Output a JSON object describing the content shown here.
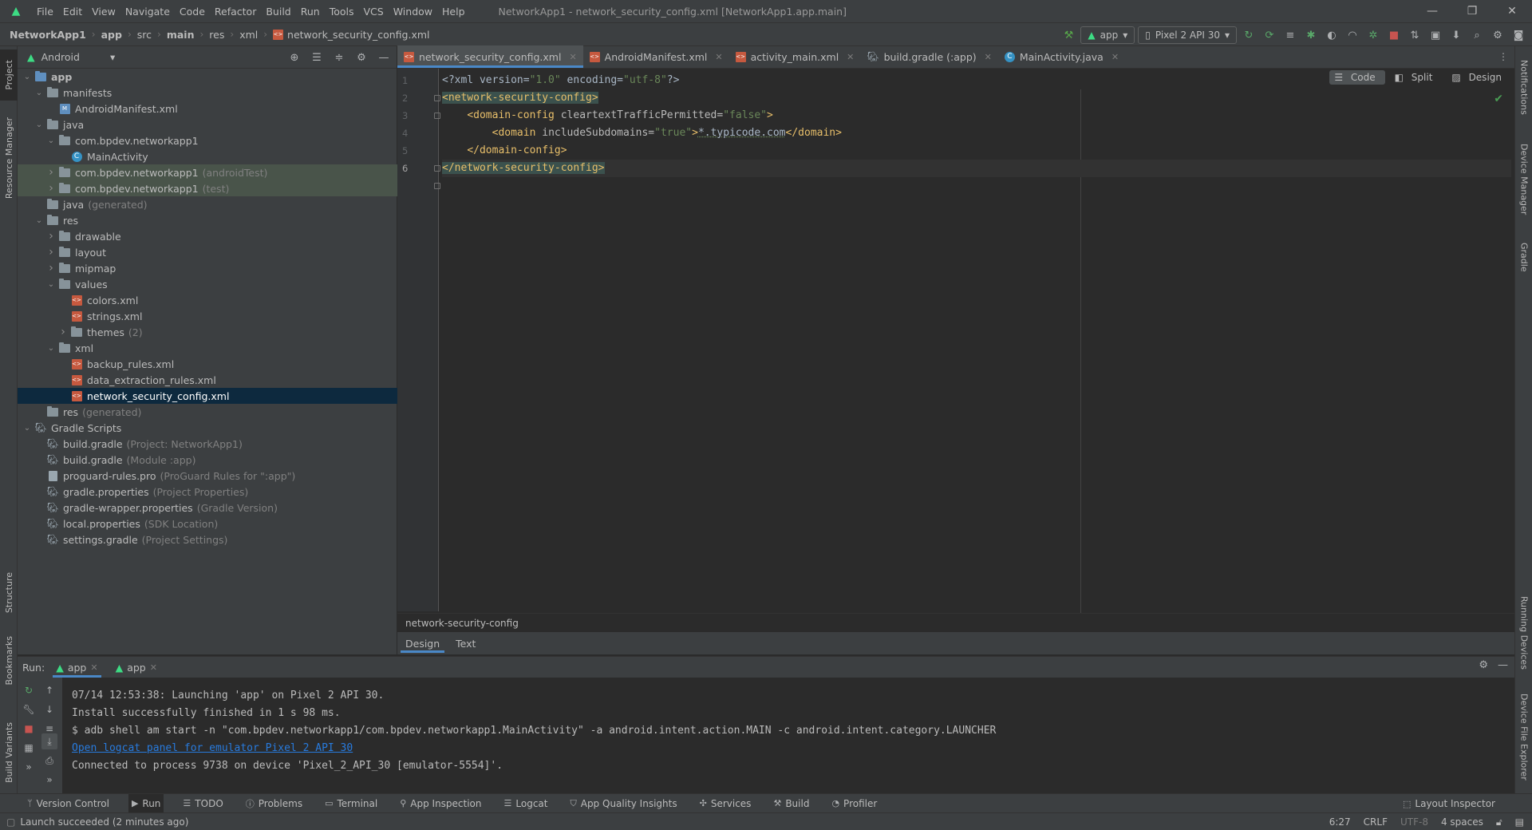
{
  "menubar": {
    "items": [
      "File",
      "Edit",
      "View",
      "Navigate",
      "Code",
      "Refactor",
      "Build",
      "Run",
      "Tools",
      "VCS",
      "Window",
      "Help"
    ],
    "window_title": "NetworkApp1 - network_security_config.xml [NetworkApp1.app.main]"
  },
  "navbar": {
    "breadcrumbs": [
      "NetworkApp1",
      "app",
      "src",
      "main",
      "res",
      "xml",
      "network_security_config.xml"
    ],
    "run_config": "app",
    "device": "Pixel 2 API 30"
  },
  "left_strip": {
    "project": "Project",
    "resource_manager": "Resource Manager",
    "structure": "Structure",
    "bookmarks": "Bookmarks",
    "build_variants": "Build Variants"
  },
  "right_strip": {
    "notifications": "Notifications",
    "device_manager": "Device Manager",
    "gradle": "Gradle",
    "running_devices": "Running Devices",
    "device_file_explorer": "Device File Explorer"
  },
  "project_panel": {
    "view_mode": "Android",
    "tree": [
      {
        "label": "app",
        "hint": "",
        "level": 0,
        "arrow": "down",
        "icon": "folder-blue",
        "bold": true
      },
      {
        "label": "manifests",
        "hint": "",
        "level": 1,
        "arrow": "down",
        "icon": "folder"
      },
      {
        "label": "AndroidManifest.xml",
        "hint": "",
        "level": 2,
        "arrow": "",
        "icon": "manifest"
      },
      {
        "label": "java",
        "hint": "",
        "level": 1,
        "arrow": "down",
        "icon": "folder"
      },
      {
        "label": "com.bpdev.networkapp1",
        "hint": "",
        "level": 2,
        "arrow": "down",
        "icon": "folder"
      },
      {
        "label": "MainActivity",
        "hint": "",
        "level": 3,
        "arrow": "",
        "icon": "class"
      },
      {
        "label": "com.bpdev.networkapp1",
        "hint": "(androidTest)",
        "level": 2,
        "arrow": "right",
        "icon": "folder",
        "gen": true
      },
      {
        "label": "com.bpdev.networkapp1",
        "hint": "(test)",
        "level": 2,
        "arrow": "right",
        "icon": "folder",
        "gen": true
      },
      {
        "label": "java",
        "hint": "(generated)",
        "level": 1,
        "arrow": "",
        "icon": "folder"
      },
      {
        "label": "res",
        "hint": "",
        "level": 1,
        "arrow": "down",
        "icon": "folder"
      },
      {
        "label": "drawable",
        "hint": "",
        "level": 2,
        "arrow": "right",
        "icon": "folder"
      },
      {
        "label": "layout",
        "hint": "",
        "level": 2,
        "arrow": "right",
        "icon": "folder"
      },
      {
        "label": "mipmap",
        "hint": "",
        "level": 2,
        "arrow": "right",
        "icon": "folder"
      },
      {
        "label": "values",
        "hint": "",
        "level": 2,
        "arrow": "down",
        "icon": "folder"
      },
      {
        "label": "colors.xml",
        "hint": "",
        "level": 3,
        "arrow": "",
        "icon": "xml"
      },
      {
        "label": "strings.xml",
        "hint": "",
        "level": 3,
        "arrow": "",
        "icon": "xml"
      },
      {
        "label": "themes",
        "hint": "(2)",
        "level": 3,
        "arrow": "right",
        "icon": "folder"
      },
      {
        "label": "xml",
        "hint": "",
        "level": 2,
        "arrow": "down",
        "icon": "folder"
      },
      {
        "label": "backup_rules.xml",
        "hint": "",
        "level": 3,
        "arrow": "",
        "icon": "xml"
      },
      {
        "label": "data_extraction_rules.xml",
        "hint": "",
        "level": 3,
        "arrow": "",
        "icon": "xml"
      },
      {
        "label": "network_security_config.xml",
        "hint": "",
        "level": 3,
        "arrow": "",
        "icon": "xml",
        "selected": true
      },
      {
        "label": "res",
        "hint": "(generated)",
        "level": 1,
        "arrow": "",
        "icon": "folder"
      },
      {
        "label": "Gradle Scripts",
        "hint": "",
        "level": 0,
        "arrow": "down",
        "icon": "gradle"
      },
      {
        "label": "build.gradle",
        "hint": "(Project: NetworkApp1)",
        "level": 1,
        "arrow": "",
        "icon": "gradle"
      },
      {
        "label": "build.gradle",
        "hint": "(Module :app)",
        "level": 1,
        "arrow": "",
        "icon": "gradle"
      },
      {
        "label": "proguard-rules.pro",
        "hint": "(ProGuard Rules for \":app\")",
        "level": 1,
        "arrow": "",
        "icon": "file"
      },
      {
        "label": "gradle.properties",
        "hint": "(Project Properties)",
        "level": 1,
        "arrow": "",
        "icon": "gradle"
      },
      {
        "label": "gradle-wrapper.properties",
        "hint": "(Gradle Version)",
        "level": 1,
        "arrow": "",
        "icon": "gradle"
      },
      {
        "label": "local.properties",
        "hint": "(SDK Location)",
        "level": 1,
        "arrow": "",
        "icon": "gradle"
      },
      {
        "label": "settings.gradle",
        "hint": "(Project Settings)",
        "level": 1,
        "arrow": "",
        "icon": "gradle"
      }
    ]
  },
  "editor": {
    "tabs": [
      {
        "label": "network_security_config.xml",
        "icon": "xml",
        "active": true
      },
      {
        "label": "AndroidManifest.xml",
        "icon": "manifest",
        "active": false
      },
      {
        "label": "activity_main.xml",
        "icon": "xml",
        "active": false
      },
      {
        "label": "build.gradle (:app)",
        "icon": "gradle",
        "active": false
      },
      {
        "label": "MainActivity.java",
        "icon": "class",
        "active": false
      }
    ],
    "view_modes": [
      "Code",
      "Split",
      "Design"
    ],
    "line_numbers": [
      "1",
      "2",
      "3",
      "4",
      "5",
      "6"
    ],
    "code": {
      "l1_open": "<?xml version=",
      "l1_ver": "\"1.0\"",
      "l1_mid": " encoding=",
      "l1_enc": "\"utf-8\"",
      "l1_close": "?>",
      "l2_tag": "<network-security-config>",
      "l3_indent": "    ",
      "l3_tag": "<domain-config",
      "l3_attr": " cleartextTrafficPermitted=",
      "l3_val": "\"false\"",
      "l3_close": ">",
      "l4_indent": "        ",
      "l4_tag": "<domain",
      "l4_attr": " includeSubdomains=",
      "l4_val": "\"true\"",
      "l4_gt": ">",
      "l4_text": "*.typicode.com",
      "l4_end": "</domain>",
      "l5_indent": "    ",
      "l5_tag": "</domain-config>",
      "l6_tag": "</network-security-config>"
    },
    "breadcrumb": "network-security-config",
    "design_tabs": [
      "Design",
      "Text"
    ]
  },
  "run_panel": {
    "label": "Run:",
    "tabs": [
      "app",
      "app"
    ],
    "lines": [
      "07/14 12:53:38: Launching 'app' on Pixel 2 API 30.",
      "Install successfully finished in 1 s 98 ms.",
      "$ adb shell am start -n \"com.bpdev.networkapp1/com.bpdev.networkapp1.MainActivity\" -a android.intent.action.MAIN -c android.intent.category.LAUNCHER",
      "Open logcat panel for emulator Pixel 2 API 30",
      "Connected to process 9738 on device 'Pixel_2_API_30 [emulator-5554]'."
    ]
  },
  "bottom_tools": {
    "version_control": "Version Control",
    "run": "Run",
    "todo": "TODO",
    "problems": "Problems",
    "terminal": "Terminal",
    "app_inspection": "App Inspection",
    "logcat": "Logcat",
    "app_quality": "App Quality Insights",
    "services": "Services",
    "build": "Build",
    "profiler": "Profiler",
    "layout_inspector": "Layout Inspector"
  },
  "status": {
    "message": "Launch succeeded (2 minutes ago)",
    "position": "6:27",
    "line_sep": "CRLF",
    "encoding": "UTF-8",
    "indent": "4 spaces"
  },
  "colors": {
    "accent": "#4a88c7",
    "android_green": "#3ddc84",
    "xml_tag": "#e8bf6a",
    "xml_value": "#6a8759",
    "link": "#287bde"
  }
}
